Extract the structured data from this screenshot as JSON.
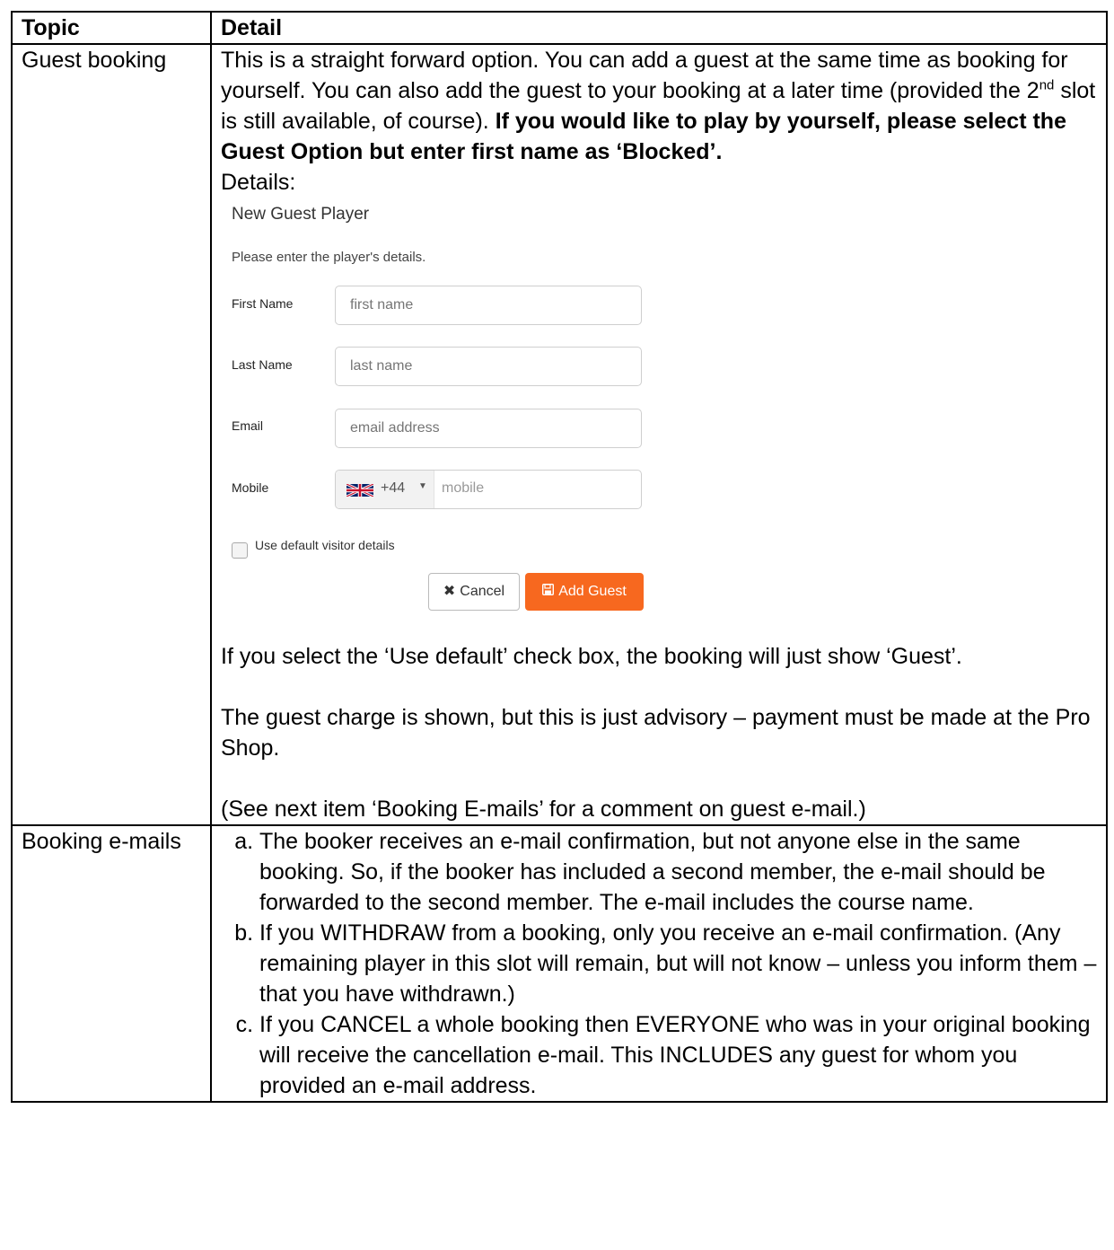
{
  "table": {
    "header": {
      "topic": "Topic",
      "detail": "Detail"
    },
    "guest": {
      "topic": "Guest booking",
      "intro_1": "This is a straight forward option.  You can add a guest at the same time as booking for yourself.  You can also add the guest to your booking at a later time (provided the 2",
      "intro_sup": "nd",
      "intro_2": " slot is still available, of course). ",
      "intro_bold": "If you would like to play by yourself, please select the Guest Option but enter first name as ‘Blocked’.",
      "details_label": "Details:",
      "form": {
        "title": "New Guest Player",
        "subtitle": "Please enter the player's details.",
        "first_name_label": "First Name",
        "first_name_placeholder": "first name",
        "last_name_label": "Last Name",
        "last_name_placeholder": "last name",
        "email_label": "Email",
        "email_placeholder": "email address",
        "mobile_label": "Mobile",
        "country_code": "+44",
        "mobile_placeholder": "mobile",
        "checkbox_label": "Use default visitor details",
        "cancel_label": "Cancel",
        "add_label": "Add Guest",
        "accent_color": "#f7681f"
      },
      "note_default": "If you select the ‘Use default’ check box, the booking will just show ‘Guest’.",
      "note_charge": "The guest charge is shown, but this is just advisory – payment must be made at the Pro Shop.",
      "note_email": "(See next item ‘Booking E-mails’ for a comment on guest e-mail.)"
    },
    "emails": {
      "topic": "Booking e-mails",
      "items": [
        "The booker receives an e-mail confirmation, but not anyone else in the same booking.  So, if the booker has included a second member, the e-mail should be forwarded to the second member.  The e-mail includes the course name.",
        "If you WITHDRAW from a booking, only you receive an e-mail confirmation. (Any remaining player in this slot will remain, but will not know – unless you inform them – that you have withdrawn.)",
        "If you CANCEL a whole booking then EVERYONE who was in your original booking will receive the cancellation e-mail.  This INCLUDES any guest for whom you provided an e-mail address."
      ]
    }
  }
}
